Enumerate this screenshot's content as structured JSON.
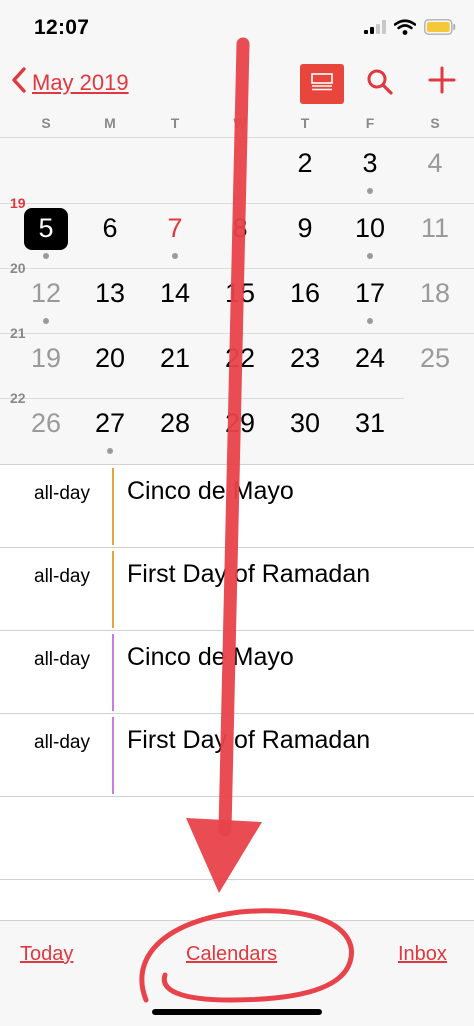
{
  "status_bar": {
    "time": "12:07"
  },
  "nav": {
    "back_label": "May 2019"
  },
  "weekdays": [
    "S",
    "M",
    "T",
    "W",
    "T",
    "F",
    "S"
  ],
  "weeks": [
    {
      "number": "",
      "days": [
        "",
        "",
        "",
        "",
        "2",
        "3",
        "4"
      ],
      "dots": [
        false,
        false,
        false,
        false,
        false,
        true,
        false
      ]
    },
    {
      "number": "19",
      "days": [
        "5",
        "6",
        "7",
        "8",
        "9",
        "10",
        "11"
      ],
      "dots": [
        true,
        false,
        true,
        false,
        false,
        true,
        false
      ]
    },
    {
      "number": "20",
      "days": [
        "12",
        "13",
        "14",
        "15",
        "16",
        "17",
        "18"
      ],
      "dots": [
        true,
        false,
        false,
        false,
        false,
        true,
        false
      ]
    },
    {
      "number": "21",
      "days": [
        "19",
        "20",
        "21",
        "22",
        "23",
        "24",
        "25"
      ],
      "dots": [
        false,
        false,
        false,
        false,
        false,
        false,
        false
      ]
    },
    {
      "number": "22",
      "days": [
        "26",
        "27",
        "28",
        "29",
        "30",
        "31",
        ""
      ],
      "dots": [
        false,
        true,
        false,
        false,
        false,
        false,
        false
      ]
    }
  ],
  "selected_day": "5",
  "today": "7",
  "events": [
    {
      "time": "all-day",
      "title": "Cinco de Mayo",
      "color": "#e6a43c"
    },
    {
      "time": "all-day",
      "title": "First Day of Ramadan",
      "color": "#e6a43c"
    },
    {
      "time": "all-day",
      "title": "Cinco de Mayo",
      "color": "#c77ee0"
    },
    {
      "time": "all-day",
      "title": "First Day of Ramadan",
      "color": "#c77ee0"
    }
  ],
  "tab_bar": {
    "today": "Today",
    "calendars": "Calendars",
    "inbox": "Inbox"
  },
  "colors": {
    "accent": "#e0383e",
    "list_button": "#e8453c",
    "annotation": "#e8424a"
  },
  "icons": {
    "back": "chevron-left-icon",
    "list": "list-view-icon",
    "search": "search-icon",
    "add": "plus-icon",
    "signal": "signal-icon",
    "wifi": "wifi-icon",
    "battery": "battery-icon"
  }
}
